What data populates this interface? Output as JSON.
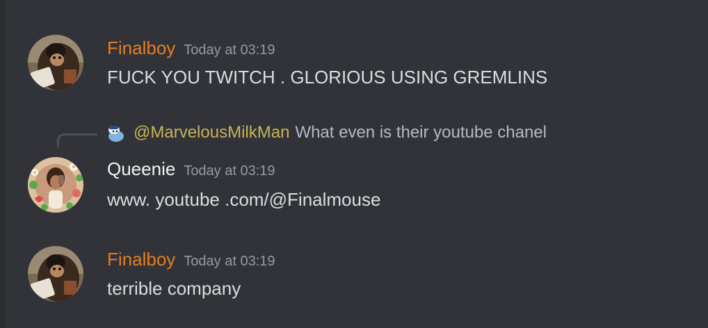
{
  "colors": {
    "background": "#313338",
    "finalboy_name": "#e67e22",
    "queenie_name": "#f2f3f5",
    "mention": "#c9b458",
    "timestamp": "#949ba4",
    "message_text": "#dbdee1"
  },
  "messages": [
    {
      "username": "Finalboy",
      "timestamp": "Today at 03:19",
      "text": "FUCK YOU TWITCH . GLORIOUS USING GREMLINS",
      "avatar": "monkey-avatar"
    },
    {
      "reply": {
        "mention": "@MarvelousMilkMan",
        "text": "What even is their youtube chanel",
        "avatar": "milkman-avatar"
      },
      "username": "Queenie",
      "timestamp": "Today at 03:19",
      "text": "www. youtube .com/@Finalmouse",
      "avatar": "queenie-flower-avatar"
    },
    {
      "username": "Finalboy",
      "timestamp": "Today at 03:19",
      "text": "terrible company",
      "avatar": "monkey-avatar"
    }
  ]
}
